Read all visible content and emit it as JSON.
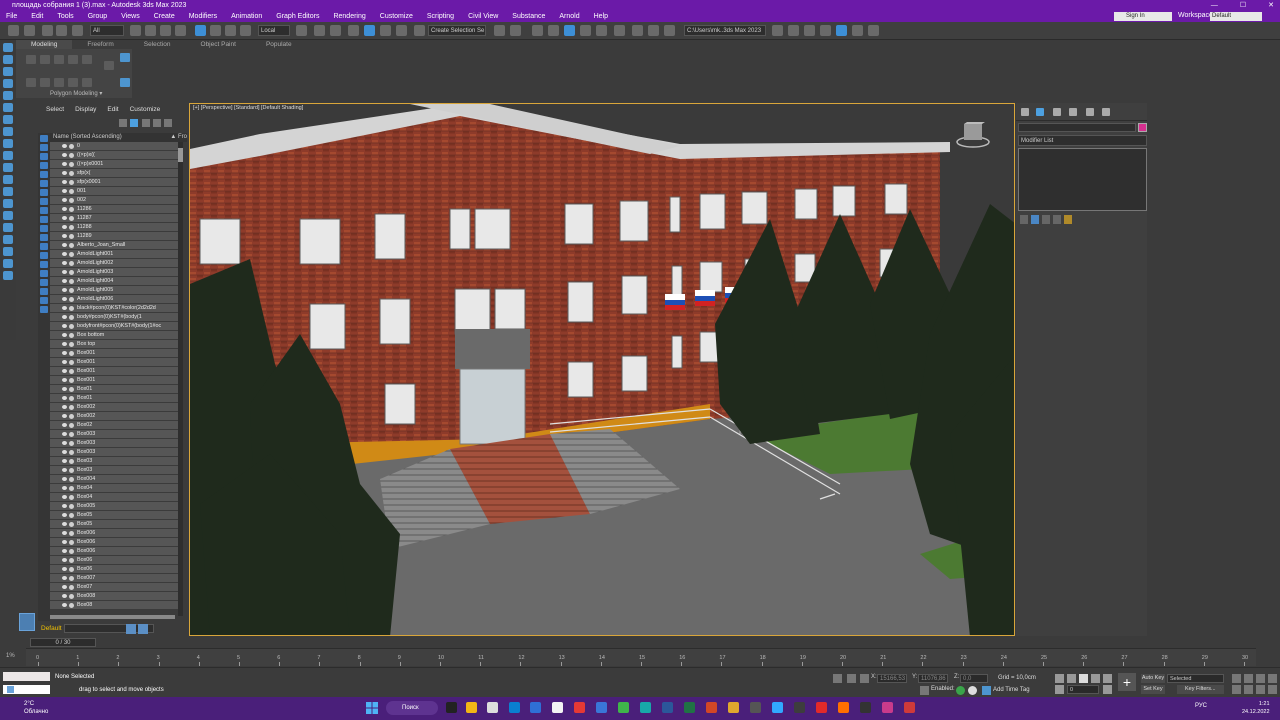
{
  "window": {
    "title": "площадь собрания 1 (3).max - Autodesk 3ds Max 2023",
    "minimize": "—",
    "maximize": "☐",
    "close": "✕"
  },
  "menu": {
    "items": [
      "File",
      "Edit",
      "Tools",
      "Group",
      "Views",
      "Create",
      "Modifiers",
      "Animation",
      "Graph Editors",
      "Rendering",
      "Customize",
      "Scripting",
      "Civil View",
      "Substance",
      "Arnold",
      "Help"
    ],
    "sign_in": "Sign In",
    "workspaces_label": "Workspaces:",
    "workspace_value": "Default"
  },
  "toolbar": {
    "selection_filter": "All",
    "reference_coord": "Local",
    "selection_set": "Create Selection Se",
    "project_path": "C:\\Users\\mk..3ds Max 2023"
  },
  "ribbon": {
    "tabs": [
      "Modeling",
      "Freeform",
      "Selection",
      "Object Paint",
      "Populate"
    ],
    "active_tab": "Modeling",
    "panel_label": "Polygon Modeling ▾"
  },
  "scene_explorer": {
    "menu": [
      "Select",
      "Display",
      "Edit",
      "Customize"
    ],
    "header": "Name (Sorted Ascending)",
    "freeze_header": "▲ Fro",
    "rows": [
      "0",
      "((×p)x((",
      "((×p)x0001",
      "sfp(x(",
      "sfp(x0001",
      "001",
      "002",
      "11286",
      "11287",
      "11288",
      "11289",
      "Alberto_Joan_Small",
      "ArnoldLight001",
      "ArnoldLight002",
      "ArnoldLight003",
      "ArnoldLight004",
      "ArnoldLight005",
      "ArnoldLight006",
      "black#pcon(0)KST#color(2d2d2d",
      "body#pcon(0)KST#(body(1",
      "bodyfront#pcon(0)KST#(body(1#oc",
      "Box bottom",
      "Box top",
      "Box001",
      "Box001",
      "Box001",
      "Box001",
      "Box01",
      "Box01",
      "Box002",
      "Box002",
      "Box02",
      "Box003",
      "Box003",
      "Box003",
      "Box03",
      "Box03",
      "Box004",
      "Box04",
      "Box04",
      "Box005",
      "Box05",
      "Box05",
      "Box006",
      "Box006",
      "Box006",
      "Box06",
      "Box06",
      "Box007",
      "Box07",
      "Box008",
      "Box08"
    ]
  },
  "layer": {
    "name": "Default"
  },
  "viewport": {
    "label": "[+] [Perspective] [Standard] [Default Shading]",
    "colors": {
      "frame": "#d9a63a",
      "brick": "#8e3b2a",
      "roof": "#d4d4d4",
      "ground": "#6a6a6a",
      "grass": "#4c7a32",
      "tree": "#1f2a1c"
    }
  },
  "command_panel": {
    "modifier_list": "Modifier List",
    "object_color": "#d6308f"
  },
  "timeline": {
    "frame_counter": "0 / 30",
    "ticks": [
      "0",
      "1",
      "2",
      "3",
      "4",
      "5",
      "6",
      "7",
      "8",
      "9",
      "10",
      "11",
      "12",
      "13",
      "14",
      "15",
      "16",
      "17",
      "18",
      "19",
      "20",
      "21",
      "22",
      "23",
      "24",
      "25",
      "26",
      "27",
      "28",
      "29",
      "30"
    ],
    "left_label": "1%"
  },
  "status": {
    "selection": "None Selected",
    "prompt": "drag to select and move objects",
    "x_label": "X:",
    "y_label": "Y:",
    "z_label": "Z:",
    "x_value": "15166,53",
    "y_value": "11076,86",
    "z_value": "0,0",
    "grid": "Grid = 10,0cm",
    "enabled": "Enabled:",
    "add_time_tag": "Add Time Tag",
    "auto_key": "Auto Key",
    "set_key": "Set Key",
    "selected_dropdown": "Selected",
    "key_filters": "Key Filters...",
    "frame_field": "0"
  },
  "taskbar": {
    "temperature": "2°C",
    "weather": "Облачно",
    "search": "Поиск",
    "language": "РУС",
    "time": "1:21",
    "date": "24.12.2022"
  }
}
